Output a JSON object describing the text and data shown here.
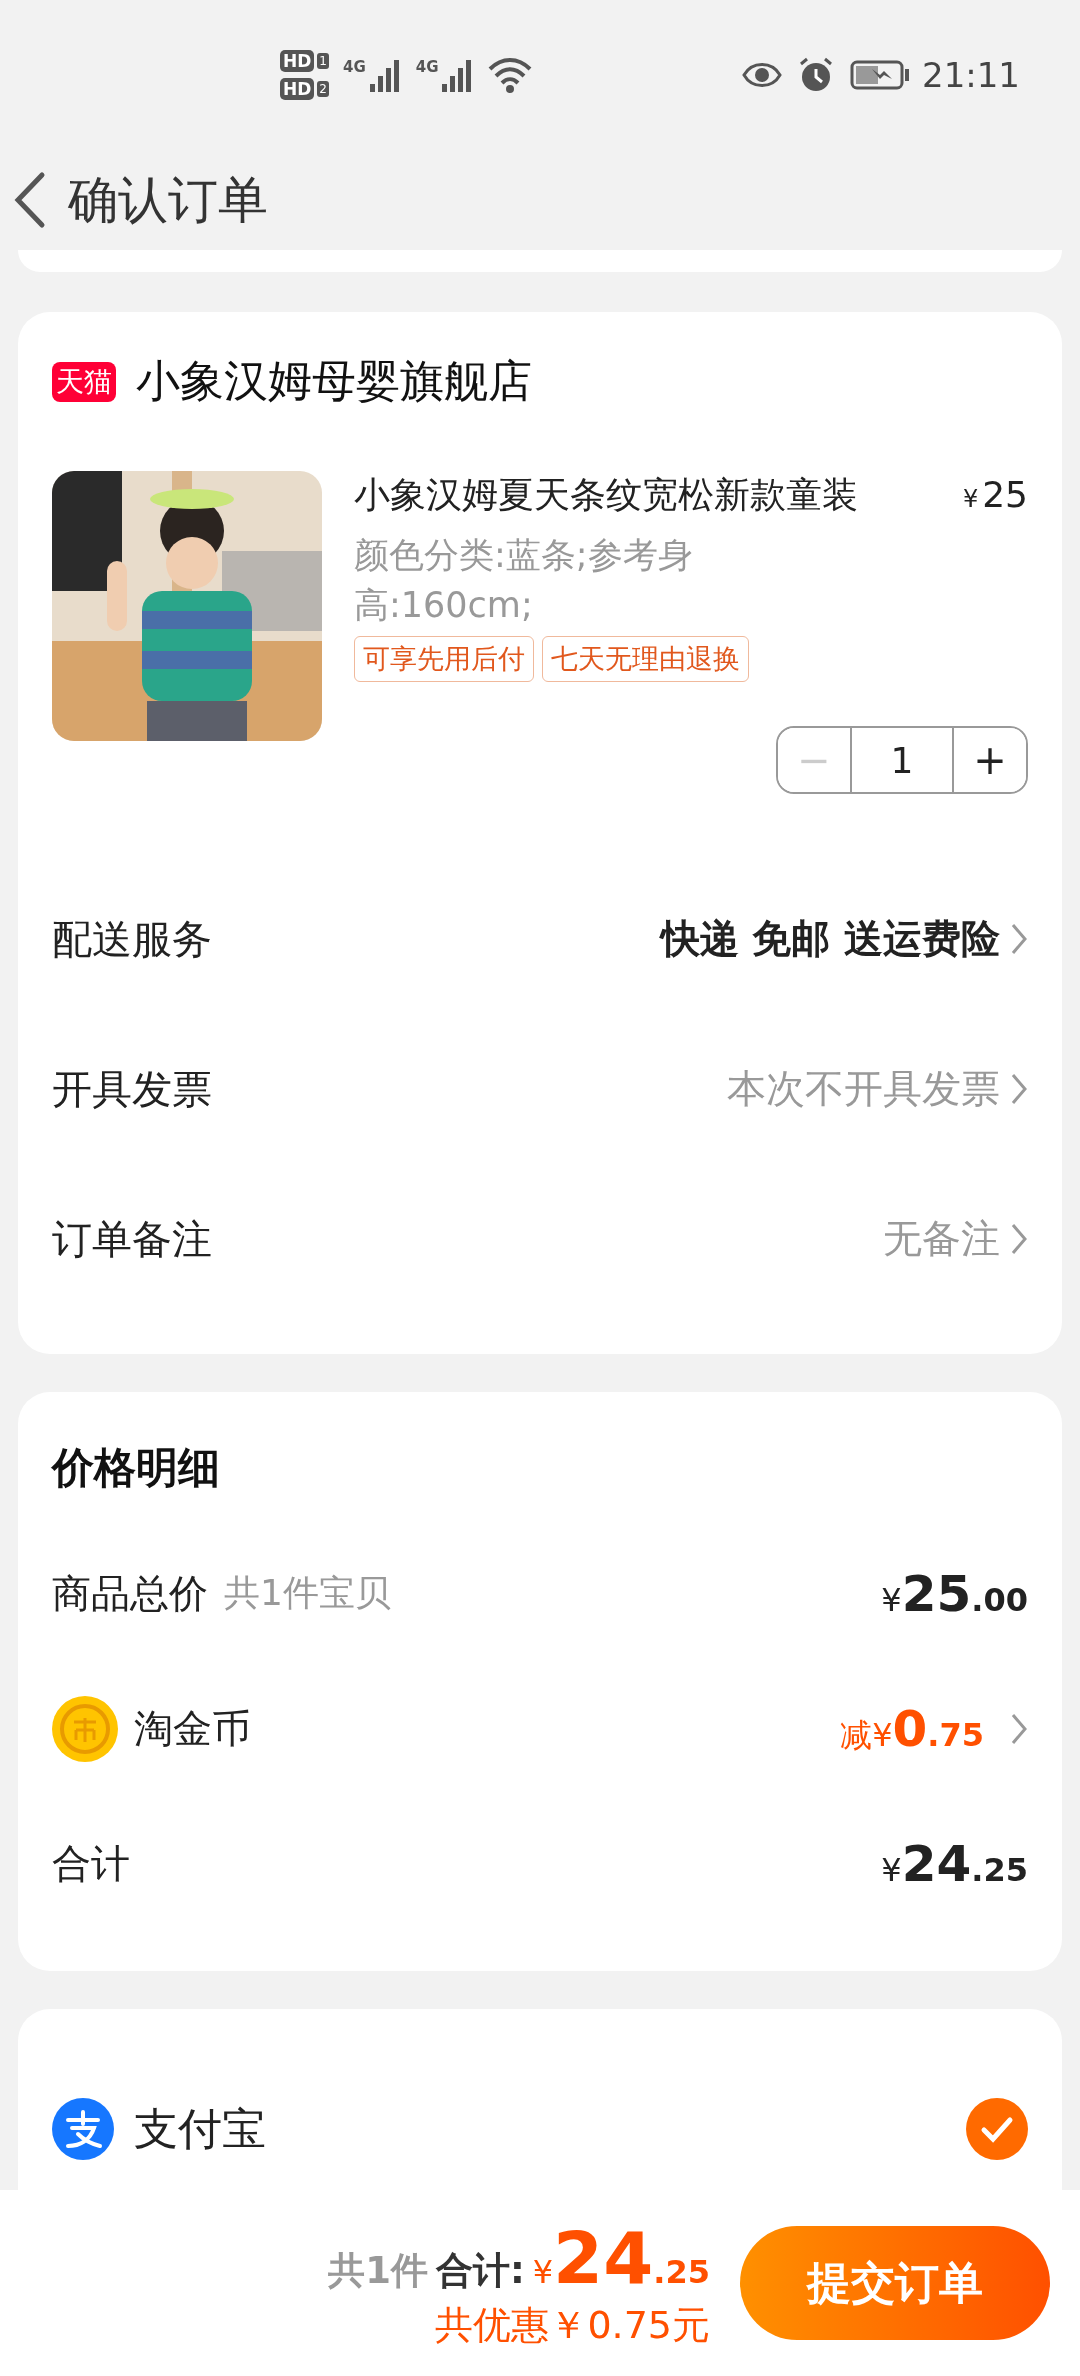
{
  "status_bar": {
    "sims": [
      {
        "label": "HD",
        "slot": "1"
      },
      {
        "label": "HD",
        "slot": "2"
      }
    ],
    "networks": [
      "4G",
      "4G"
    ],
    "time": "21:11"
  },
  "header": {
    "title": "确认订单"
  },
  "shop": {
    "badge": "天猫",
    "name": "小象汉姆母婴旗舰店",
    "product": {
      "title": "小象汉姆夏天条纹宽松新款童装",
      "currency": "¥",
      "price": "25",
      "variant": "颜色分类:蓝条;参考身高:160cm;",
      "tags": [
        "可享先用后付",
        "七天无理由退换"
      ],
      "quantity": {
        "minus": "−",
        "value": "1",
        "plus": "+",
        "minus_disabled": true
      }
    },
    "rows": [
      {
        "label": "配送服务",
        "value": "快递 免邮 送运费险",
        "strong": true
      },
      {
        "label": "开具发票",
        "value": "本次不开具发票",
        "strong": false
      },
      {
        "label": "订单备注",
        "value": "无备注",
        "strong": false
      }
    ]
  },
  "price_detail": {
    "title": "价格明细",
    "lines": [
      {
        "kind": "total",
        "label": "商品总价",
        "note": "共1件宝贝",
        "currency": "¥",
        "integer": "25",
        "decimal": ".00"
      },
      {
        "kind": "coin",
        "label": "淘金币",
        "prefix": "减",
        "currency": "¥",
        "integer": "0",
        "decimal": ".75"
      },
      {
        "kind": "sum",
        "label": "合计",
        "currency": "¥",
        "integer": "24",
        "decimal": ".25"
      }
    ]
  },
  "payment": {
    "options": [
      {
        "kind": "alipay",
        "name": "支付宝",
        "selected": true
      }
    ]
  },
  "bottom_bar": {
    "count": "共1件",
    "label": "合计:",
    "currency": "¥",
    "integer": "24",
    "decimal": ".25",
    "discount": "共优惠￥0.75元",
    "button": "提交订单"
  }
}
